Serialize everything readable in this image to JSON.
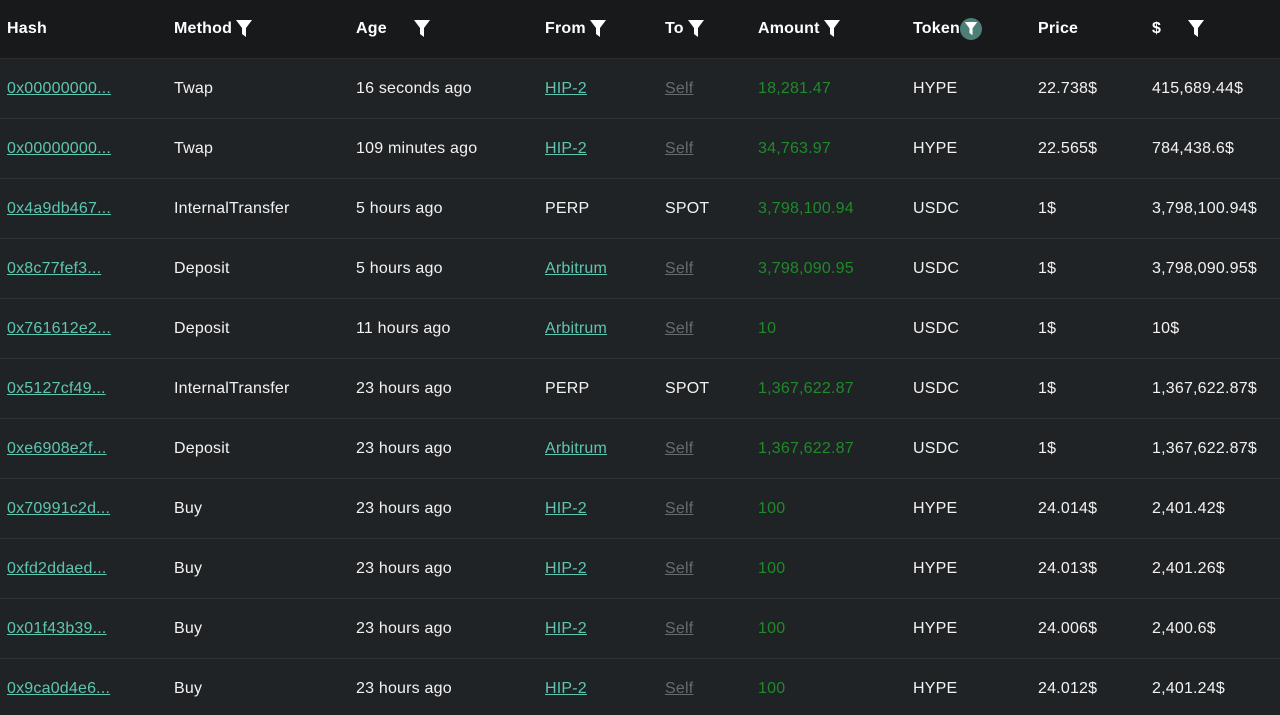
{
  "columns": {
    "hash": "Hash",
    "method": "Method",
    "age": "Age",
    "from": "From",
    "to": "To",
    "amount": "Amount",
    "token": "Token",
    "price": "Price",
    "usd": "$"
  },
  "icons": {
    "filter": "filter-icon"
  },
  "colors": {
    "background": "#202325",
    "header_background": "#17191a",
    "link": "#5ec6b0",
    "self_link": "#666b6d",
    "amount": "#1e8a2a",
    "active_filter": "#4d7f78"
  },
  "rows": [
    {
      "hash": "0x00000000...",
      "method": "Twap",
      "age": "16 seconds ago",
      "from": "HIP-2",
      "to": "Self",
      "amount": "18,281.47",
      "token": "HYPE",
      "price": "22.738$",
      "usd": "415,689.44$"
    },
    {
      "hash": "0x00000000...",
      "method": "Twap",
      "age": "109 minutes ago",
      "from": "HIP-2",
      "to": "Self",
      "amount": "34,763.97",
      "token": "HYPE",
      "price": "22.565$",
      "usd": "784,438.6$"
    },
    {
      "hash": "0x4a9db467...",
      "method": "InternalTransfer",
      "age": "5 hours ago",
      "from": "PERP",
      "to": "SPOT",
      "amount": "3,798,100.94",
      "token": "USDC",
      "price": "1$",
      "usd": "3,798,100.94$"
    },
    {
      "hash": "0x8c77fef3...",
      "method": "Deposit",
      "age": "5 hours ago",
      "from": "Arbitrum",
      "to": "Self",
      "amount": "3,798,090.95",
      "token": "USDC",
      "price": "1$",
      "usd": "3,798,090.95$"
    },
    {
      "hash": "0x761612e2...",
      "method": "Deposit",
      "age": "11 hours ago",
      "from": "Arbitrum",
      "to": "Self",
      "amount": "10",
      "token": "USDC",
      "price": "1$",
      "usd": "10$"
    },
    {
      "hash": "0x5127cf49...",
      "method": "InternalTransfer",
      "age": "23 hours ago",
      "from": "PERP",
      "to": "SPOT",
      "amount": "1,367,622.87",
      "token": "USDC",
      "price": "1$",
      "usd": "1,367,622.87$"
    },
    {
      "hash": "0xe6908e2f...",
      "method": "Deposit",
      "age": "23 hours ago",
      "from": "Arbitrum",
      "to": "Self",
      "amount": "1,367,622.87",
      "token": "USDC",
      "price": "1$",
      "usd": "1,367,622.87$"
    },
    {
      "hash": "0x70991c2d...",
      "method": "Buy",
      "age": "23 hours ago",
      "from": "HIP-2",
      "to": "Self",
      "amount": "100",
      "token": "HYPE",
      "price": "24.014$",
      "usd": "2,401.42$"
    },
    {
      "hash": "0xfd2ddaed...",
      "method": "Buy",
      "age": "23 hours ago",
      "from": "HIP-2",
      "to": "Self",
      "amount": "100",
      "token": "HYPE",
      "price": "24.013$",
      "usd": "2,401.26$"
    },
    {
      "hash": "0x01f43b39...",
      "method": "Buy",
      "age": "23 hours ago",
      "from": "HIP-2",
      "to": "Self",
      "amount": "100",
      "token": "HYPE",
      "price": "24.006$",
      "usd": "2,400.6$"
    },
    {
      "hash": "0x9ca0d4e6...",
      "method": "Buy",
      "age": "23 hours ago",
      "from": "HIP-2",
      "to": "Self",
      "amount": "100",
      "token": "HYPE",
      "price": "24.012$",
      "usd": "2,401.24$"
    }
  ]
}
